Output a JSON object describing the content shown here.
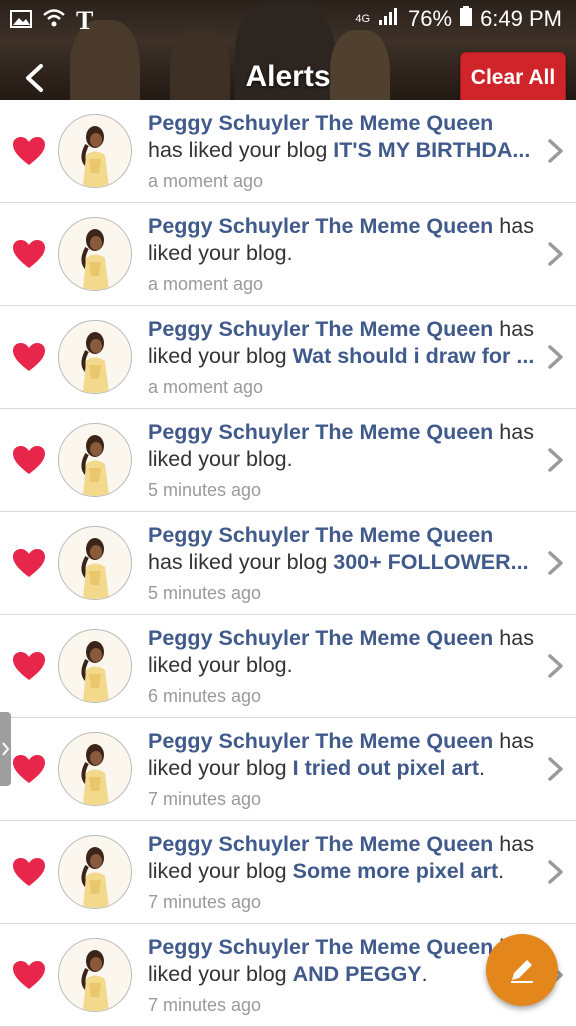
{
  "status_bar": {
    "carrier_glyph": "T",
    "network": "4G",
    "battery": "76%",
    "time": "6:49 PM"
  },
  "header": {
    "title": "Alerts",
    "clear_all": "Clear All"
  },
  "alerts": [
    {
      "user": "Peggy Schuyler The Meme Queen",
      "action": "has liked your blog",
      "blog": "IT'S MY BIRTHDA...",
      "suffix": "",
      "time": "a moment ago",
      "layout": "name-line"
    },
    {
      "user": "Peggy Schuyler The Meme Queen",
      "action": "has",
      "action2": "liked your blog.",
      "blog": "",
      "suffix": "",
      "time": "a moment ago",
      "layout": "inline"
    },
    {
      "user": "Peggy Schuyler The Meme Queen",
      "action": "has",
      "action2": "liked your blog",
      "blog": "Wat should i draw for ...",
      "suffix": "",
      "time": "a moment ago",
      "layout": "inline"
    },
    {
      "user": "Peggy Schuyler The Meme Queen",
      "action": "has",
      "action2": "liked your blog.",
      "blog": "",
      "suffix": "",
      "time": "5 minutes ago",
      "layout": "inline"
    },
    {
      "user": "Peggy Schuyler The Meme Queen",
      "action": "has liked your blog",
      "blog": "300+ FOLLOWER...",
      "suffix": "",
      "time": "5 minutes ago",
      "layout": "name-line"
    },
    {
      "user": "Peggy Schuyler The Meme Queen",
      "action": "has",
      "action2": "liked your blog.",
      "blog": "",
      "suffix": "",
      "time": "6 minutes ago",
      "layout": "inline"
    },
    {
      "user": "Peggy Schuyler The Meme Queen",
      "action": "has",
      "action2": "liked your blog",
      "blog": "I tried out pixel art",
      "suffix": ".",
      "time": "7 minutes ago",
      "layout": "inline"
    },
    {
      "user": "Peggy Schuyler The Meme Queen",
      "action": "has",
      "action2": "liked your blog",
      "blog": "Some more pixel art",
      "suffix": ".",
      "time": "7 minutes ago",
      "layout": "inline"
    },
    {
      "user": "Peggy Schuyler The Meme Queen",
      "action": "has",
      "action2": "liked your blog",
      "blog": "AND PEGGY",
      "suffix": ".",
      "time": "7 minutes ago",
      "layout": "inline"
    }
  ],
  "icons": {
    "heart": "heart-icon",
    "chevron": "chevron-right-icon",
    "fab": "pencil-icon",
    "back": "back-arrow-icon"
  },
  "colors": {
    "heart": "#e8254a",
    "link": "#415a8c",
    "clear_button": "#d0242b",
    "fab": "#e3861b"
  }
}
